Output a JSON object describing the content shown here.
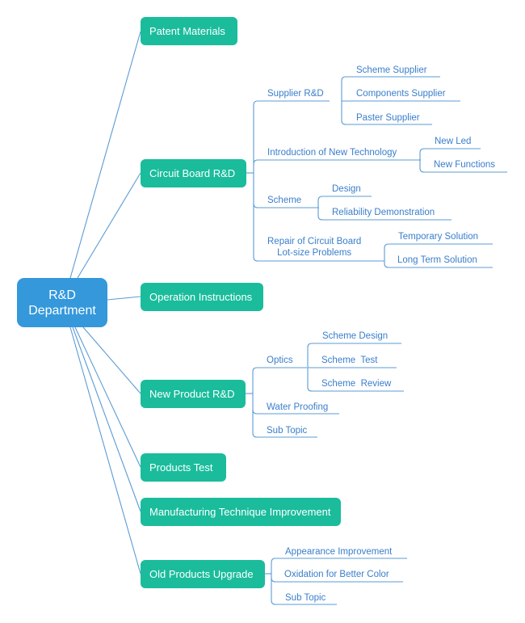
{
  "colors": {
    "root": "#3498db",
    "topic": "#1abc9c",
    "line": "#5b9bd5",
    "subtext": "#3a7ecb"
  },
  "root": {
    "line1": "R&D",
    "line2": "Department"
  },
  "topics": [
    {
      "label": "Patent Materials"
    },
    {
      "label": "Circuit Board R&D",
      "children": [
        {
          "label": "Supplier R&D",
          "children": [
            "Scheme Supplier",
            "Components Supplier",
            "Paster Supplier"
          ]
        },
        {
          "label": "Introduction of New Technology",
          "children": [
            "New Led",
            "New Functions"
          ]
        },
        {
          "label": "Scheme",
          "children": [
            "Design",
            "Reliability Demonstration"
          ]
        },
        {
          "label_line1": "Repair of  Circuit Board",
          "label_line2": "Lot-size Problems",
          "children": [
            "Temporary Solution",
            "Long Term Solution"
          ]
        }
      ]
    },
    {
      "label": "Operation Instructions"
    },
    {
      "label": "New Product R&D",
      "children": [
        {
          "label": "Optics",
          "children": [
            "Scheme Design",
            "Scheme  Test",
            "Scheme  Review"
          ]
        },
        {
          "label": "Water Proofing"
        },
        {
          "label": "Sub Topic"
        }
      ]
    },
    {
      "label": "Products Test"
    },
    {
      "label": "Manufacturing Technique Improvement"
    },
    {
      "label": "Old Products Upgrade",
      "children": [
        {
          "label": "Appearance Improvement"
        },
        {
          "label": "Oxidation for Better Color"
        },
        {
          "label": "Sub Topic"
        }
      ]
    }
  ]
}
